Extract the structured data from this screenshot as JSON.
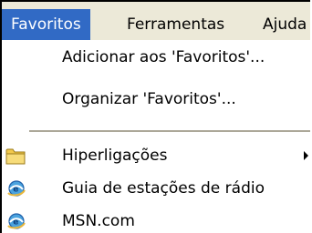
{
  "menubar": {
    "items": [
      {
        "label": "Favoritos",
        "active": true
      },
      {
        "label": "Ferramentas"
      },
      {
        "label": "Ajuda"
      }
    ]
  },
  "dropdown": {
    "items": [
      {
        "label": "Adicionar aos 'Favoritos'..."
      },
      {
        "label": "Organizar 'Favoritos'..."
      },
      {
        "label": "Hiperligações",
        "icon": "folder-icon",
        "has_submenu": true
      },
      {
        "label": "Guia de estações de rádio",
        "icon": "ie-page-icon"
      },
      {
        "label": "MSN.com",
        "icon": "ie-page-icon"
      }
    ]
  },
  "colors": {
    "menubar_bg": "#ece9d8",
    "highlight": "#316ac5",
    "separator": "#aca899"
  }
}
